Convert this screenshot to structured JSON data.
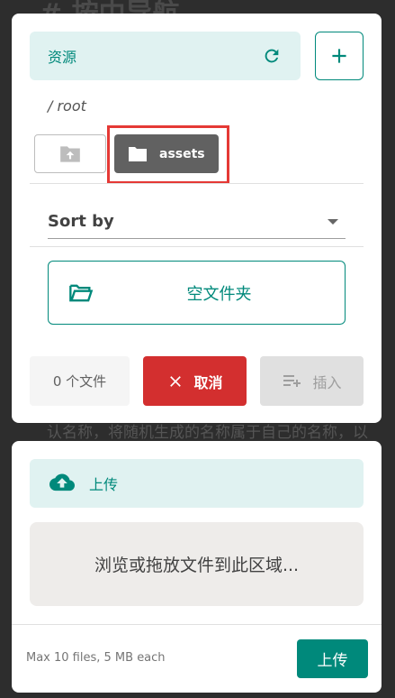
{
  "background": {
    "title": "# 按中导航",
    "line": "认名称，将随机生成的名称属于自己的名称，以"
  },
  "resources": {
    "label": "资源",
    "path": "/ root",
    "folders": [
      {
        "name": "assets"
      }
    ],
    "sort_label": "Sort by",
    "empty_folder_label": "空文件夹",
    "file_count": "0 个文件",
    "cancel_label": "取消",
    "insert_label": "插入"
  },
  "upload": {
    "label": "上传",
    "dropzone_text": "浏览或拖放文件到此区域...",
    "limit_text": "Max 10 files, 5 MB each",
    "button_label": "上传"
  },
  "colors": {
    "accent": "#00897b",
    "danger": "#d32f2f",
    "folder_selected": "#616161",
    "highlight": "#e53935"
  }
}
